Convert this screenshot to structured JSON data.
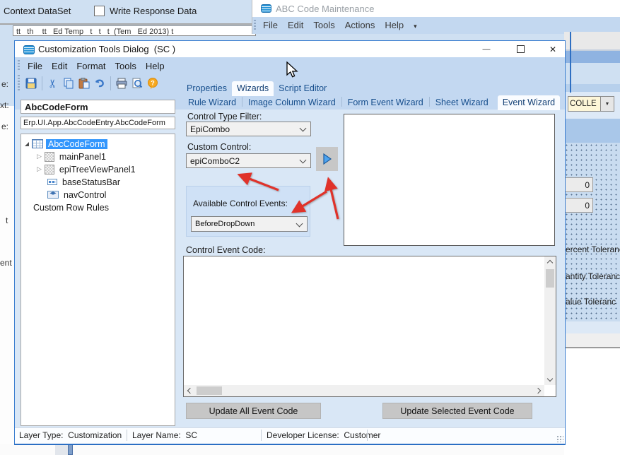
{
  "backdrop": {
    "context_dataset_label": "Context DataSet",
    "write_response_label": "Write Response Data",
    "clipped_path": "tt   th    tt   Ed Temp   t   t   t  (Tem   Ed 2013) t",
    "fragment_1": "e:",
    "fragment_2": "xt:",
    "fragment_3": "e:",
    "fragment_4": "t",
    "fragment_5": "ent"
  },
  "abc_window": {
    "title": "ABC Code Maintenance",
    "menu": [
      "File",
      "Edit",
      "Tools",
      "Actions",
      "Help"
    ],
    "menu_overflow_glyph": "▾",
    "combo_value": "COLLE",
    "zero_value_1": "0",
    "zero_value_2": "0",
    "clipped_label_1": "ercent Toleranc",
    "clipped_label_2": "antity Toleranc",
    "clipped_label_3": "alue Toleranc"
  },
  "dialog": {
    "title": "Customization Tools Dialog  (SC )",
    "window_buttons": {
      "minimize": "—",
      "close": "✕"
    },
    "menu": [
      "File",
      "Edit",
      "Format",
      "Tools",
      "Help"
    ],
    "tabs": [
      "Properties",
      "Wizards",
      "Script Editor"
    ],
    "wizard_tabs": [
      "Rule Wizard",
      "Image Column Wizard",
      "Form Event Wizard",
      "Sheet Wizard",
      "Event Wizard"
    ],
    "left_panel": {
      "form_name": "AbcCodeForm",
      "form_class": "Erp.UI.App.AbcCodeEntry.AbcCodeForm",
      "tree": [
        {
          "label": "AbcCodeForm"
        },
        {
          "label": "mainPanel1"
        },
        {
          "label": "epiTreeViewPanel1"
        },
        {
          "label": "baseStatusBar"
        },
        {
          "label": "navControl"
        },
        {
          "label": "Custom Row Rules"
        }
      ]
    },
    "event_wizard": {
      "control_type_filter_label": "Control Type Filter:",
      "control_type_filter_value": "EpiCombo",
      "custom_control_label": "Custom Control:",
      "custom_control_value": "epiComboC2",
      "available_events_label": "Available Control Events:",
      "available_events_value": "BeforeDropDown",
      "code_label": "Control Event Code:",
      "update_all_button": "Update All Event Code",
      "update_selected_button": "Update Selected Event Code"
    },
    "status_bar": {
      "layer_type": "Layer Type:  Customization",
      "layer_name": "Layer Name:  SC",
      "developer_license": "Developer License:  Customer"
    }
  },
  "annotations": {
    "arrow_color": "#e0322a"
  }
}
